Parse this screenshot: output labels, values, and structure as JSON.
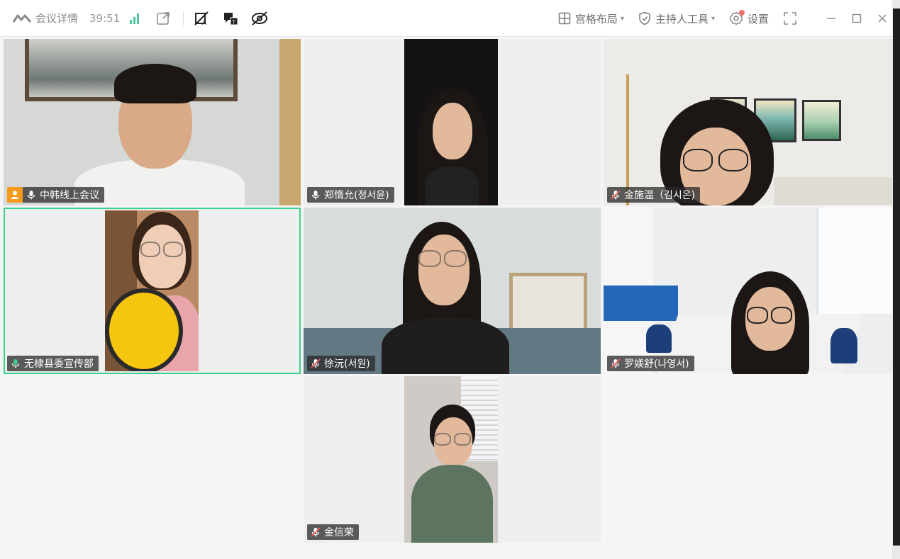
{
  "toolbar": {
    "meeting_details": "会议详情",
    "timer": "39:51",
    "layout_label": "宫格布局",
    "host_tools_label": "主持人工具",
    "settings_label": "设置"
  },
  "participants": [
    {
      "name": "中韩线上会议",
      "mic": "on",
      "host": true
    },
    {
      "name": "郑惰允(정서윤)",
      "mic": "on"
    },
    {
      "name": "金施温（김시온)",
      "mic": "muted"
    },
    {
      "name": "无棣县委宣传部",
      "mic": "speaking",
      "active": true
    },
    {
      "name": "徐沅(서원)",
      "mic": "muted"
    },
    {
      "name": "罗媄舒(나영서)",
      "mic": "muted"
    },
    {
      "name": "金信荣",
      "mic": "muted"
    }
  ],
  "colors": {
    "accent_green": "#3ccf8e",
    "host_orange": "#f59a1b",
    "signal_green": "#4ac89c",
    "mute_red": "#f05a5a"
  }
}
